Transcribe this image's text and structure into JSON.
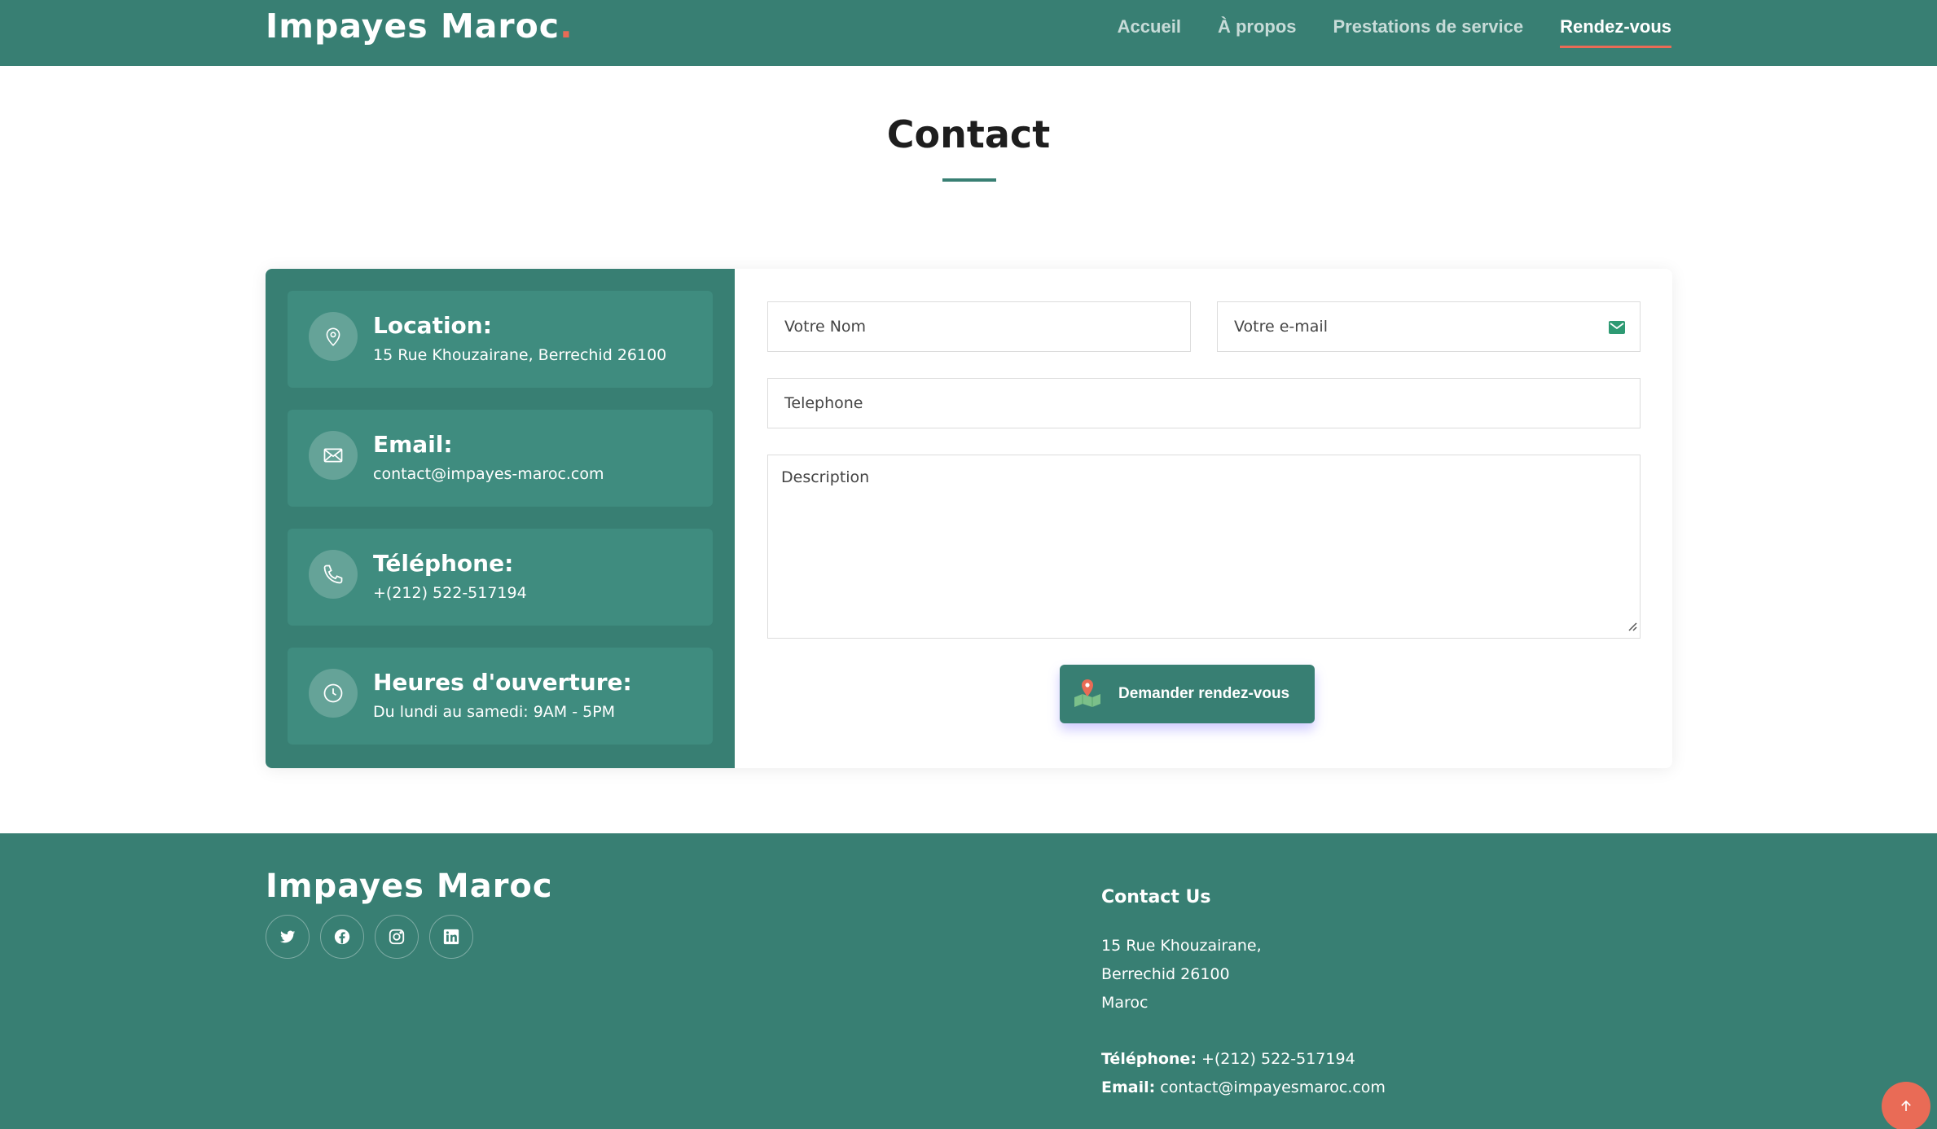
{
  "header": {
    "logo": "Impayes Maroc",
    "logo_dot": ".",
    "nav": [
      {
        "label": "Accueil",
        "active": false
      },
      {
        "label": "À propos",
        "active": false
      },
      {
        "label": "Prestations de service",
        "active": false
      },
      {
        "label": "Rendez-vous",
        "active": true
      }
    ]
  },
  "section": {
    "title": "Contact"
  },
  "info": [
    {
      "icon": "location-pin-icon",
      "title": "Location:",
      "text": "15 Rue Khouzairane, Berrechid 26100"
    },
    {
      "icon": "envelope-icon",
      "title": "Email:",
      "text": "contact@impayes-maroc.com"
    },
    {
      "icon": "phone-icon",
      "title": "Téléphone:",
      "text": "+(212) 522-517194"
    },
    {
      "icon": "clock-icon",
      "title": "Heures d'ouverture:",
      "text": "Du lundi au samedi: 9AM - 5PM"
    }
  ],
  "form": {
    "name_placeholder": "Votre Nom",
    "email_placeholder": "Votre e-mail",
    "phone_placeholder": "Telephone",
    "description_placeholder": "Description",
    "submit_label": "Demander rendez-vous"
  },
  "footer": {
    "logo": "Impayes Maroc",
    "socials": [
      "twitter-icon",
      "facebook-icon",
      "instagram-icon",
      "linkedin-icon"
    ],
    "contact_title": "Contact Us",
    "address_lines": [
      "15 Rue Khouzairane,",
      "Berrechid 26100",
      "Maroc"
    ],
    "phone_label": "Téléphone:",
    "phone_value": " +(212) 522-517194",
    "email_label": "Email:",
    "email_value": " contact@impayesmaroc.com"
  },
  "colors": {
    "brand": "#387f73",
    "accent": "#e96b56"
  }
}
